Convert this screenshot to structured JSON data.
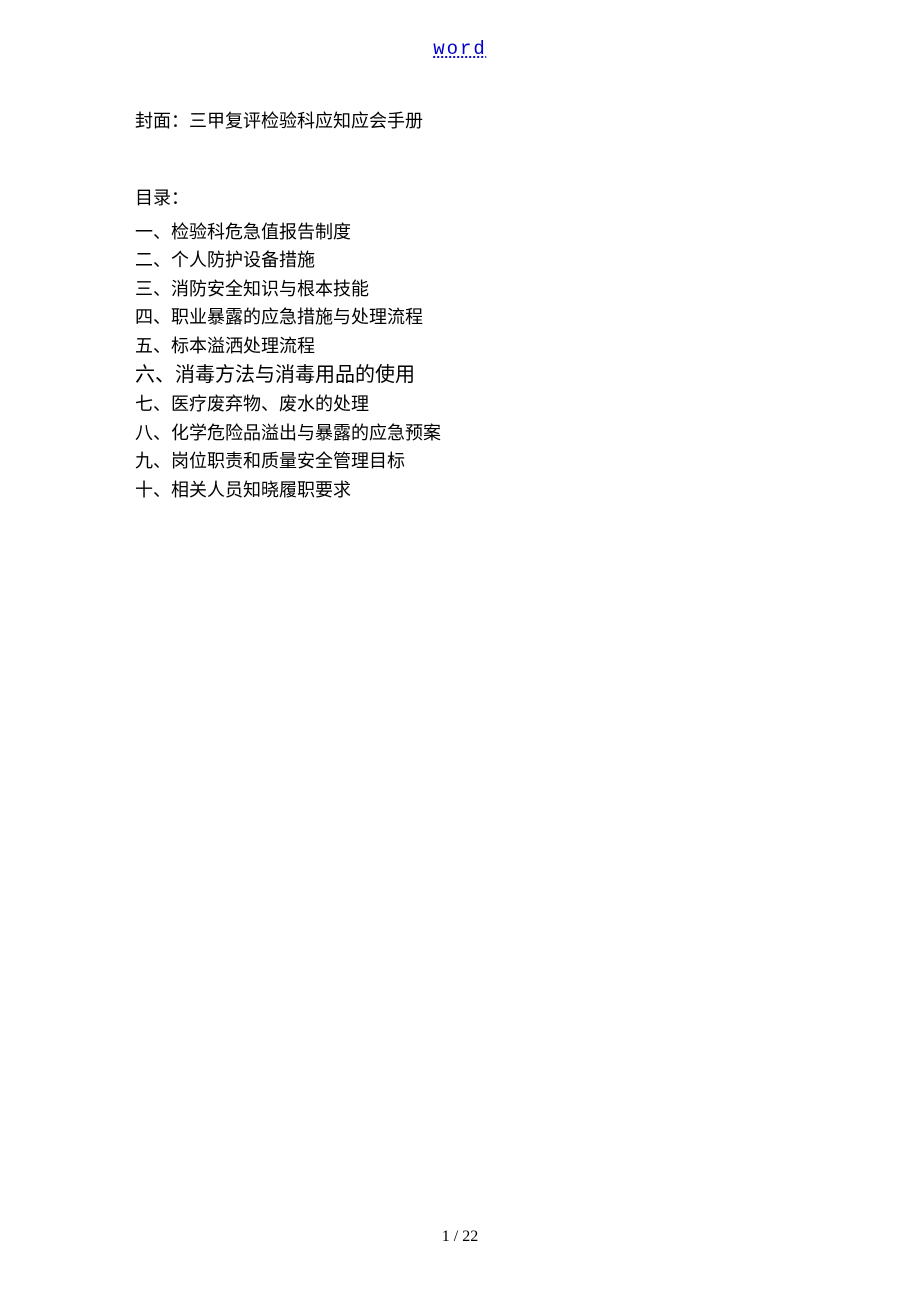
{
  "header": {
    "link_text": "word"
  },
  "cover": {
    "text": "封面：三甲复评检验科应知应会手册"
  },
  "toc": {
    "heading": "目录：",
    "items": [
      "一、检验科危急值报告制度",
      "二、个人防护设备措施",
      "三、消防安全知识与根本技能",
      "四、职业暴露的应急措施与处理流程",
      "五、标本溢洒处理流程",
      "六、消毒方法与消毒用品的使用",
      "七、医疗废弃物、废水的处理",
      "八、化学危险品溢出与暴露的应急预案",
      "九、岗位职责和质量安全管理目标",
      "十、相关人员知晓履职要求"
    ]
  },
  "footer": {
    "page_number": "1 / 22"
  }
}
